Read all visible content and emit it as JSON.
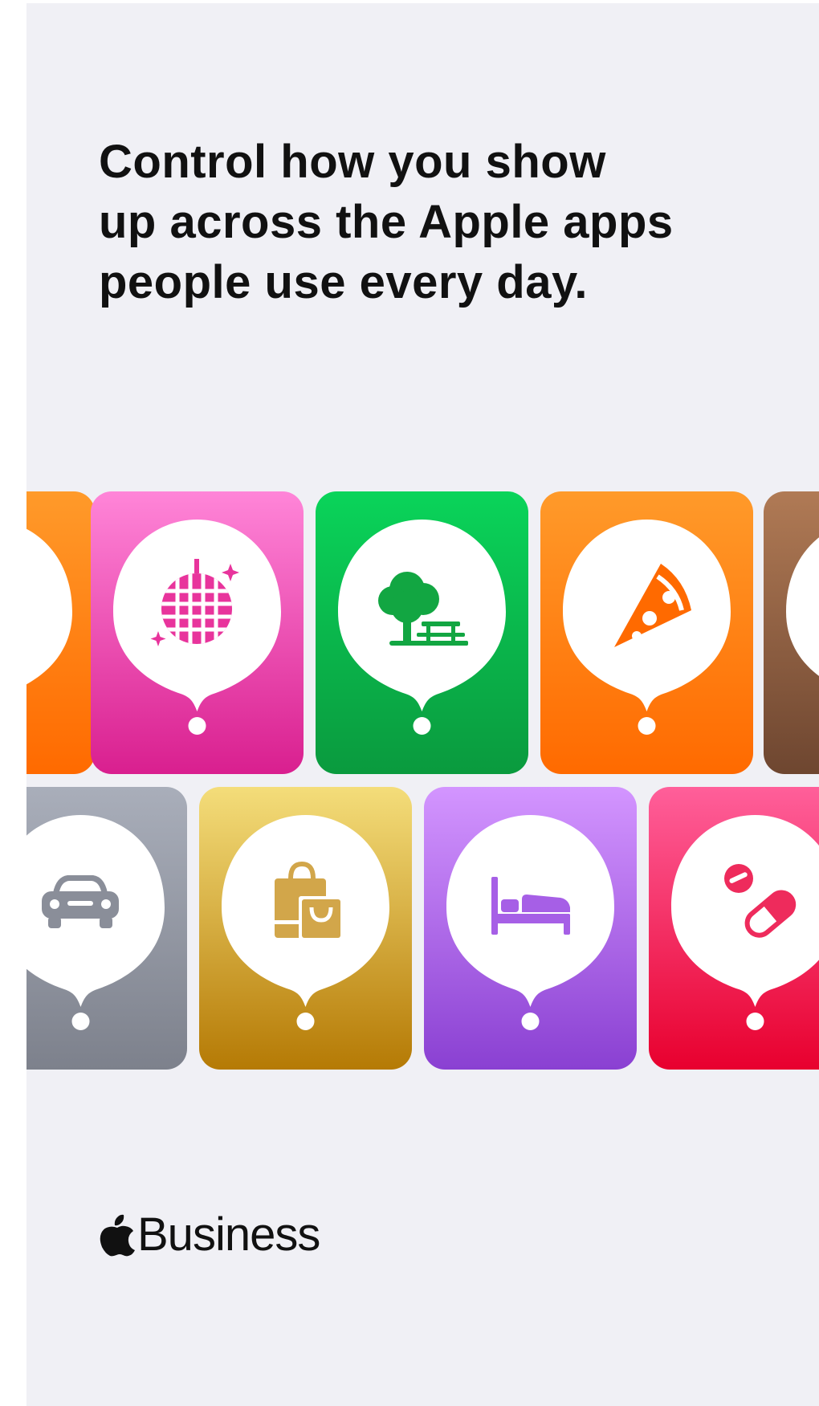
{
  "headline": {
    "line1": "Control how you show",
    "line2": "up across the Apple apps",
    "line3": "people use every day."
  },
  "brand": {
    "logo_icon": "apple-logo-icon",
    "text": "Business"
  },
  "tiles": {
    "row1": [
      {
        "icon": "partial-orange-icon",
        "color_top": "#ff9a2a",
        "color_bottom": "#ff6a00"
      },
      {
        "icon": "disco-ball-icon",
        "color_top": "#ff85d8",
        "color_bottom": "#d91f8f"
      },
      {
        "icon": "tree-picnic-icon",
        "color_top": "#0ad45a",
        "color_bottom": "#0a9a3e"
      },
      {
        "icon": "pizza-slice-icon",
        "color_top": "#ff9a2a",
        "color_bottom": "#ff6a00"
      },
      {
        "icon": "partial-brown-icon",
        "color_top": "#b07a55",
        "color_bottom": "#6e4630"
      }
    ],
    "row2": [
      {
        "icon": "car-icon",
        "color_top": "#a9aeba",
        "color_bottom": "#7d818c"
      },
      {
        "icon": "shopping-bags-icon",
        "color_top": "#f4dd7a",
        "color_bottom": "#b57a05"
      },
      {
        "icon": "bed-icon",
        "color_top": "#d395ff",
        "color_bottom": "#8a40d2"
      },
      {
        "icon": "pills-icon",
        "color_top": "#ff5f9a",
        "color_bottom": "#e8002e"
      }
    ]
  }
}
